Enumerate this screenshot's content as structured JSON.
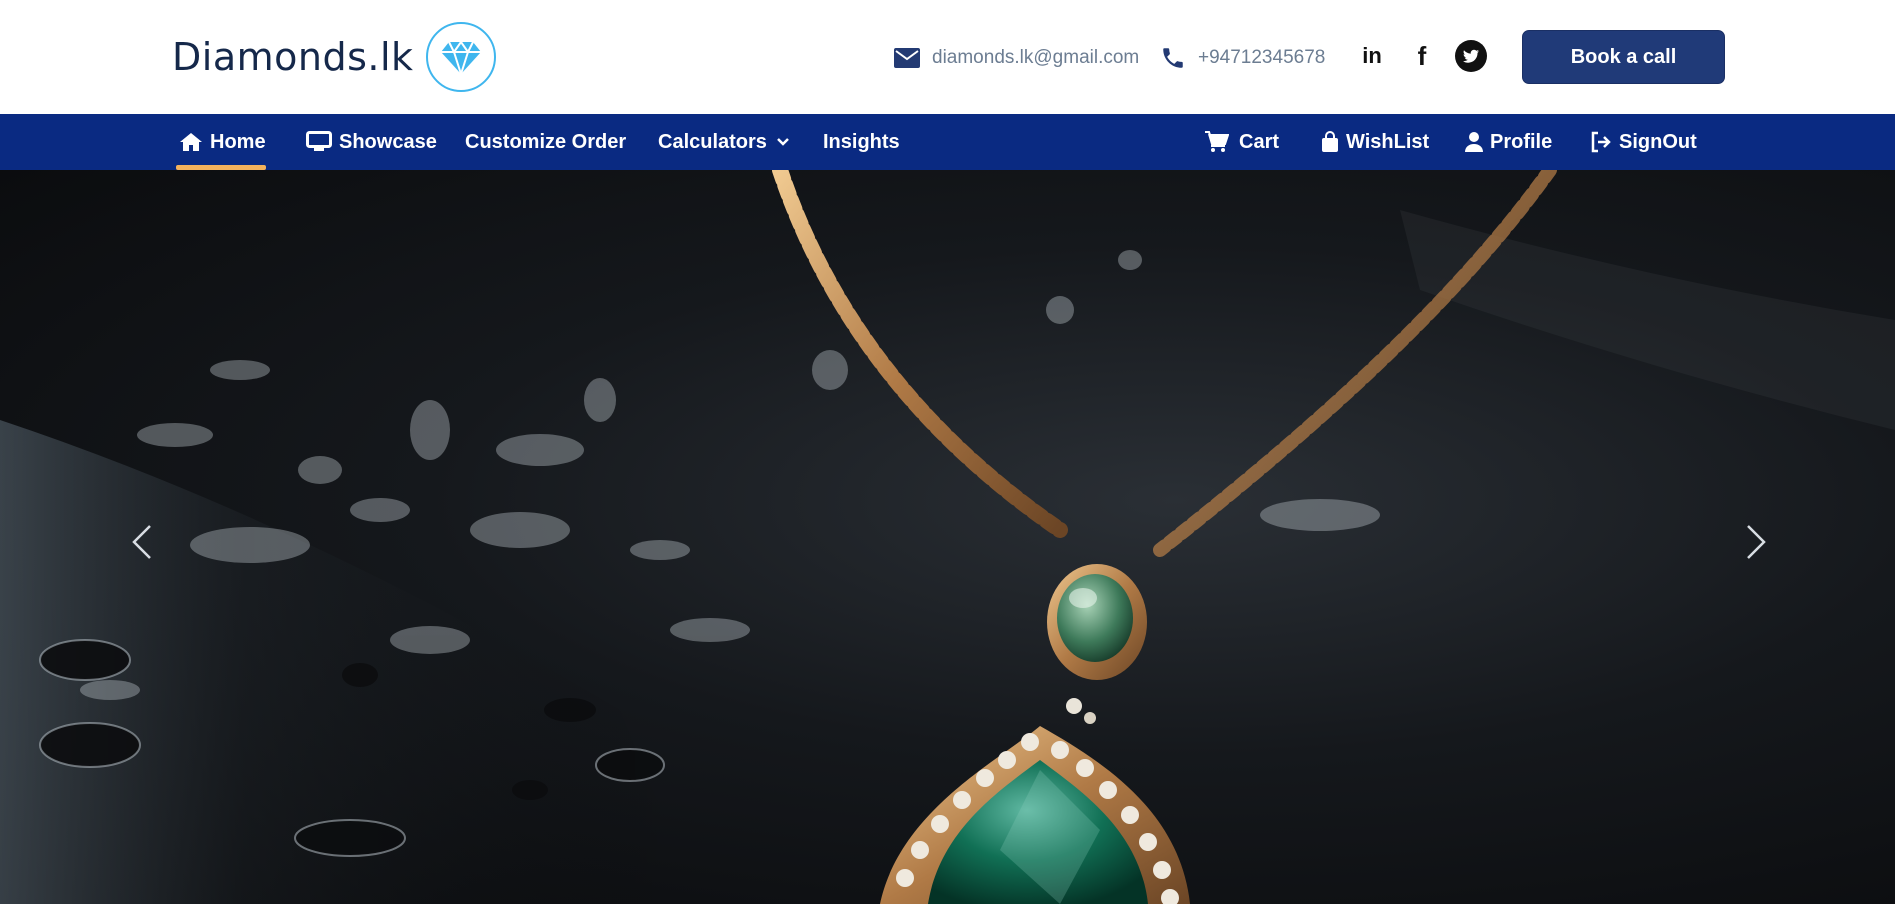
{
  "brand": {
    "name": "Diamonds.lk",
    "logo_icon": "diamond-icon",
    "logo_color": "#3fb6ee"
  },
  "contact": {
    "email": "diamonds.lk@gmail.com",
    "email_icon": "envelope-icon",
    "phone": "+94712345678",
    "phone_icon": "phone-icon"
  },
  "social": [
    {
      "name": "linkedin",
      "label": "in",
      "icon": "linkedin-icon"
    },
    {
      "name": "facebook",
      "label": "f",
      "icon": "facebook-icon"
    },
    {
      "name": "twitter",
      "label": "",
      "icon": "twitter-icon"
    }
  ],
  "cta": {
    "label": "Book a call",
    "color": "#203a78"
  },
  "nav": {
    "background": "#0a2a82",
    "active_indicator_color": "#f4b25c",
    "left": [
      {
        "label": "Home",
        "icon": "home-icon",
        "active": true
      },
      {
        "label": "Showcase",
        "icon": "monitor-icon",
        "active": false
      },
      {
        "label": "Customize Order",
        "active": false
      },
      {
        "label": "Calculators",
        "icon": "chevron-down-icon",
        "active": false
      },
      {
        "label": "Insights",
        "active": false
      }
    ],
    "right": [
      {
        "label": "Cart",
        "icon": "cart-icon"
      },
      {
        "label": "WishList",
        "icon": "shopping-bag-icon"
      },
      {
        "label": "Profile",
        "icon": "user-icon"
      },
      {
        "label": "SignOut",
        "icon": "sign-out-icon"
      }
    ]
  },
  "hero": {
    "image": "emerald-pendant-necklace",
    "prev_icon": "chevron-left-icon",
    "next_icon": "chevron-right-icon"
  }
}
